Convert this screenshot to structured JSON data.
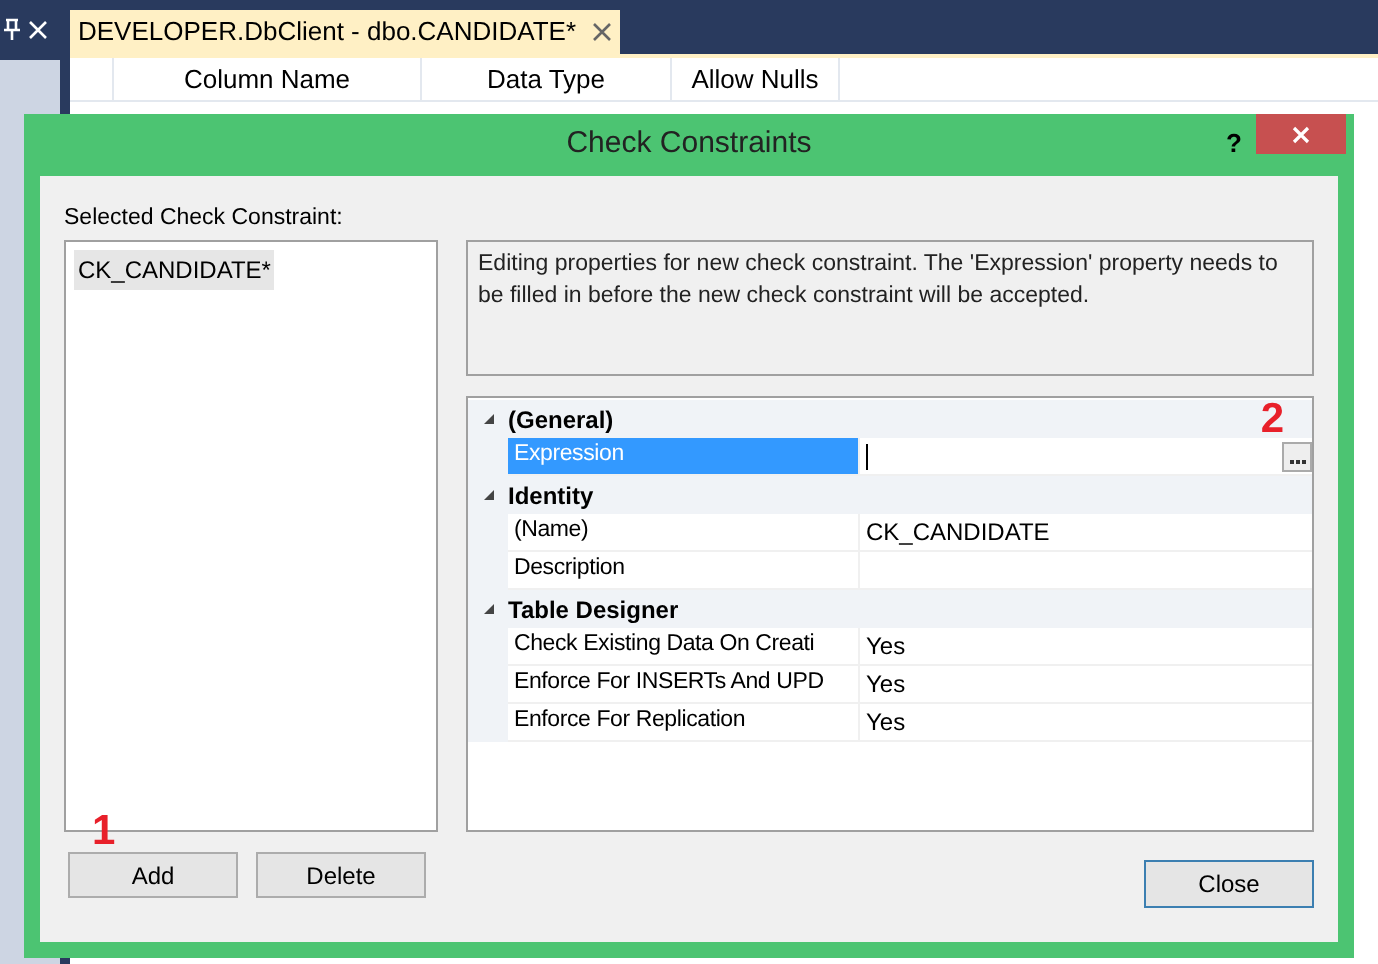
{
  "ide": {
    "tab": {
      "title": "DEVELOPER.DbClient - dbo.CANDIDATE*",
      "selected": true
    },
    "table": {
      "columns": [
        "Column Name",
        "Data Type",
        "Allow Nulls"
      ]
    }
  },
  "dialog": {
    "title": "Check Constraints",
    "help": "?",
    "selected_label": "Selected Check Constraint:",
    "constraints": [
      {
        "label": "CK_CANDIDATE*",
        "selected": true
      }
    ],
    "description": "Editing properties for new check constraint.  The 'Expression' property needs to be filled in before the new check constraint will be accepted.",
    "property_grid": [
      {
        "name": "(General)",
        "expanded": true,
        "properties": [
          {
            "name": "Expression",
            "selected": true,
            "kind": "ellipsis"
          }
        ]
      },
      {
        "name": "Identity",
        "expanded": true,
        "properties": [
          {
            "name": "(Name)",
            "value": "CK_CANDIDATE",
            "selected": false,
            "kind": "text"
          },
          {
            "name": "Description",
            "selected": false,
            "kind": "text"
          }
        ]
      },
      {
        "name": "Table Designer",
        "expanded": true,
        "properties": [
          {
            "name": "Check Existing Data On Creati",
            "value": "Yes",
            "selected": false,
            "kind": "text"
          },
          {
            "name": "Enforce For INSERTs And UPD",
            "value": "Yes",
            "selected": false,
            "kind": "text"
          },
          {
            "name": "Enforce For Replication",
            "value": "Yes",
            "selected": false,
            "kind": "text"
          }
        ]
      }
    ],
    "list_buttons": [
      "Add",
      "Delete"
    ],
    "close_button": "Close",
    "annotations": [
      "1",
      "2"
    ]
  }
}
